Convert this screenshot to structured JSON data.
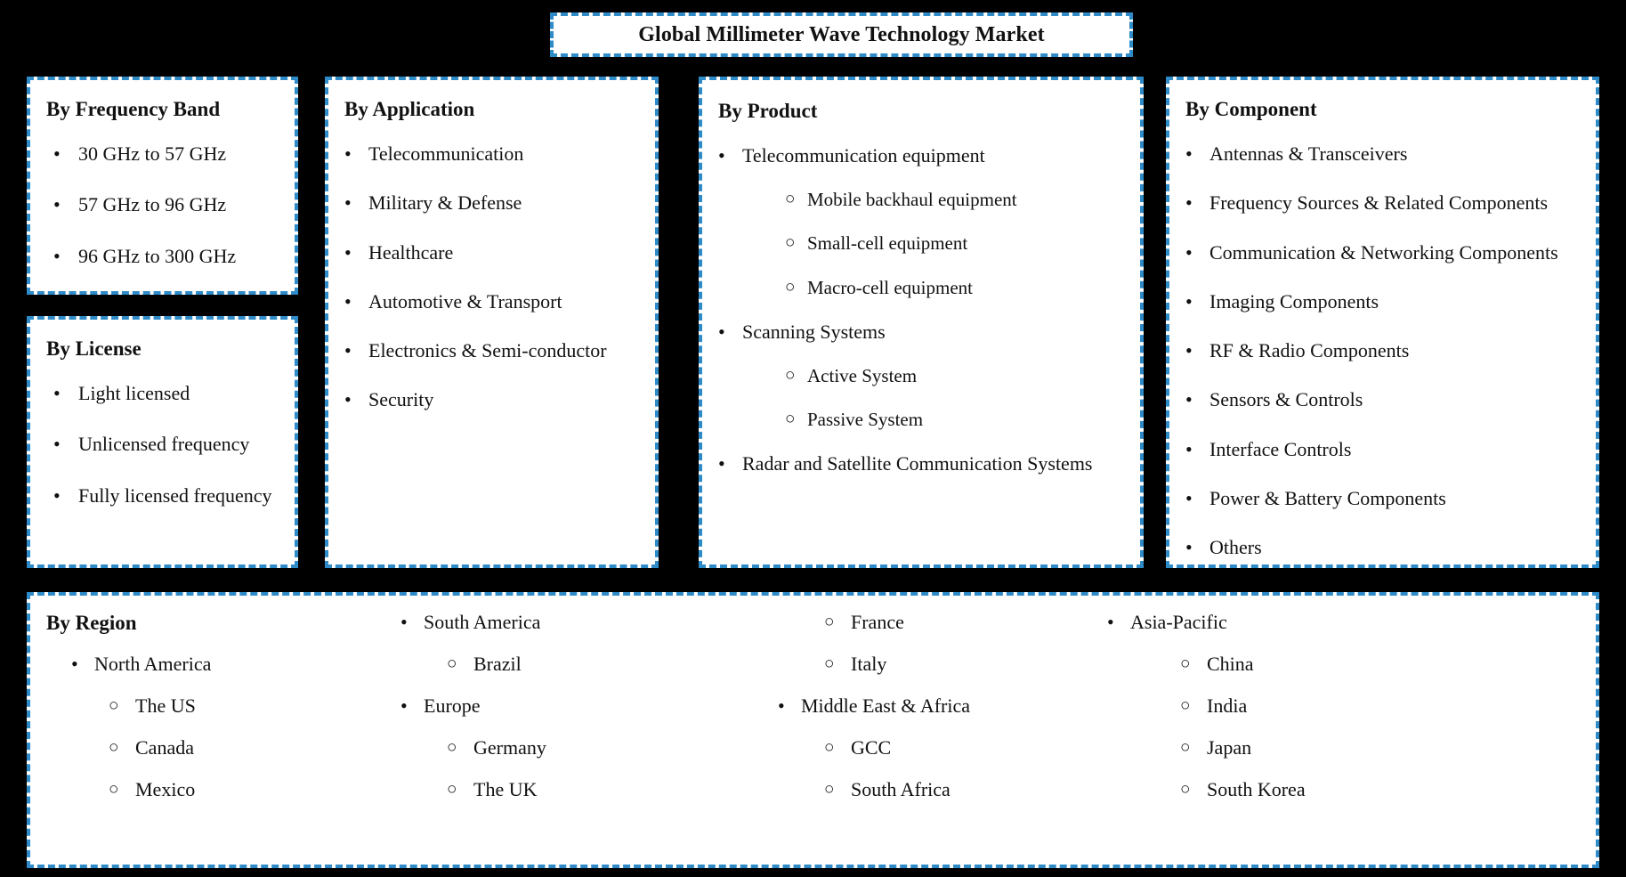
{
  "title": {
    "text": "Global Millimeter Wave Technology Market"
  },
  "bullets": {
    "disc": "•",
    "circle": "○"
  },
  "colors": {
    "border_blue": "#2E8BC8",
    "background": "#000000",
    "panel": "#FFFFFF",
    "text": "#111111"
  },
  "segments": {
    "frequency_band": {
      "heading": "By Frequency Band",
      "items": [
        "30 GHz to 57 GHz",
        "57 GHz to 96 GHz",
        "96 GHz to 300 GHz"
      ]
    },
    "license": {
      "heading": "By License",
      "items": [
        "Light licensed",
        "Unlicensed frequency",
        "Fully licensed frequency"
      ]
    },
    "application": {
      "heading": "By Application",
      "items": [
        "Telecommunication",
        "Military & Defense",
        "Healthcare",
        "Automotive & Transport",
        "Electronics & Semi-conductor",
        "Security"
      ]
    },
    "product": {
      "heading": "By Product",
      "items": [
        {
          "label": "Telecommunication equipment",
          "level": 1
        },
        {
          "label": "Mobile backhaul equipment",
          "level": 2
        },
        {
          "label": "Small-cell equipment",
          "level": 2
        },
        {
          "label": "Macro-cell equipment",
          "level": 2
        },
        {
          "label": "Scanning Systems",
          "level": 1
        },
        {
          "label": "Active System",
          "level": 2
        },
        {
          "label": "Passive System",
          "level": 2
        },
        {
          "label": "Radar and Satellite Communication Systems",
          "level": 1
        }
      ]
    },
    "component": {
      "heading": "By Component",
      "items": [
        "Antennas & Transceivers",
        "Frequency Sources & Related Components",
        "Communication & Networking Components",
        "Imaging Components",
        "RF & Radio Components",
        "Sensors & Controls",
        "Interface Controls",
        "Power & Battery Components",
        "Others"
      ]
    },
    "region": {
      "heading": "By Region",
      "rows": [
        [
          {
            "label": "By Region",
            "level": 0
          },
          {
            "label": "South America",
            "level": 1
          },
          {
            "label": "France",
            "level": 2
          },
          {
            "label": "Asia-Pacific",
            "level": 1
          }
        ],
        [
          {
            "label": "North America",
            "level": 1
          },
          {
            "label": "Brazil",
            "level": 2
          },
          {
            "label": "Italy",
            "level": 2
          },
          {
            "label": "China",
            "level": 2
          }
        ],
        [
          {
            "label": "The US",
            "level": 2
          },
          {
            "label": "Europe",
            "level": 1
          },
          {
            "label": "Middle East & Africa",
            "level": 1
          },
          {
            "label": "India",
            "level": 2
          }
        ],
        [
          {
            "label": "Canada",
            "level": 2
          },
          {
            "label": "Germany",
            "level": 2
          },
          {
            "label": "GCC",
            "level": 2
          },
          {
            "label": "Japan",
            "level": 2
          }
        ],
        [
          {
            "label": "Mexico",
            "level": 2
          },
          {
            "label": "The UK",
            "level": 2
          },
          {
            "label": "South Africa",
            "level": 2
          },
          {
            "label": "South Korea",
            "level": 2
          }
        ]
      ]
    }
  }
}
